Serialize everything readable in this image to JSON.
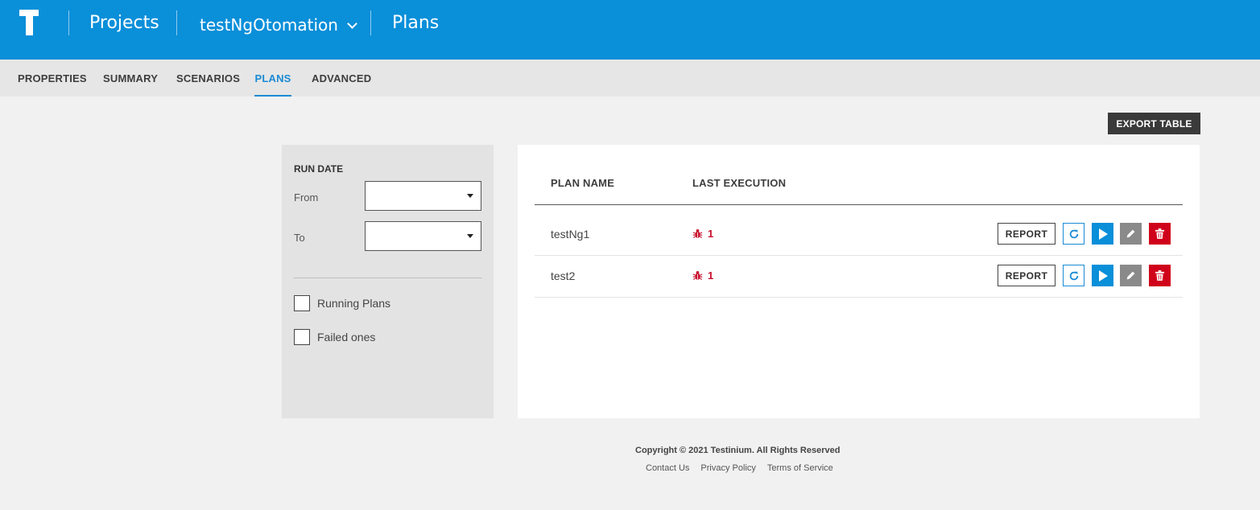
{
  "header": {
    "logo_letter": "T",
    "projects_label": "Projects",
    "project_name": "testNgOtomation",
    "page_label": "Plans",
    "background_color": "#0a8fd9"
  },
  "tabs": [
    {
      "label": "PROPERTIES",
      "active": false
    },
    {
      "label": "SUMMARY",
      "active": false
    },
    {
      "label": "SCENARIOS",
      "active": false
    },
    {
      "label": "PLANS",
      "active": true
    },
    {
      "label": "ADVANCED",
      "active": false
    }
  ],
  "toolbar": {
    "export_label": "EXPORT TABLE"
  },
  "filter": {
    "run_date_title": "RUN DATE",
    "from_label": "From",
    "from_value": "",
    "to_label": "To",
    "to_value": "",
    "running_plans_label": "Running Plans",
    "running_plans_checked": false,
    "failed_ones_label": "Failed ones",
    "failed_ones_checked": false
  },
  "table": {
    "columns": [
      "PLAN NAME",
      "LAST EXECUTION"
    ],
    "rows": [
      {
        "plan_name": "testNg1",
        "last_execution_bugs": "1",
        "report_label": "REPORT"
      },
      {
        "plan_name": "test2",
        "last_execution_bugs": "1",
        "report_label": "REPORT"
      }
    ],
    "icons": {
      "bug": "bug-icon",
      "refresh": "refresh-icon",
      "play": "play-icon",
      "edit": "pencil-icon",
      "delete": "trash-icon"
    },
    "colors": {
      "error": "#c8102e",
      "play": "#0a8fd9",
      "edit": "#8a8a8a",
      "delete": "#d0021b"
    }
  },
  "footer": {
    "copyright": "Copyright © 2021 Testinium. All Rights Reserved",
    "links": [
      "Contact Us",
      "Privacy Policy",
      "Terms of Service"
    ]
  }
}
